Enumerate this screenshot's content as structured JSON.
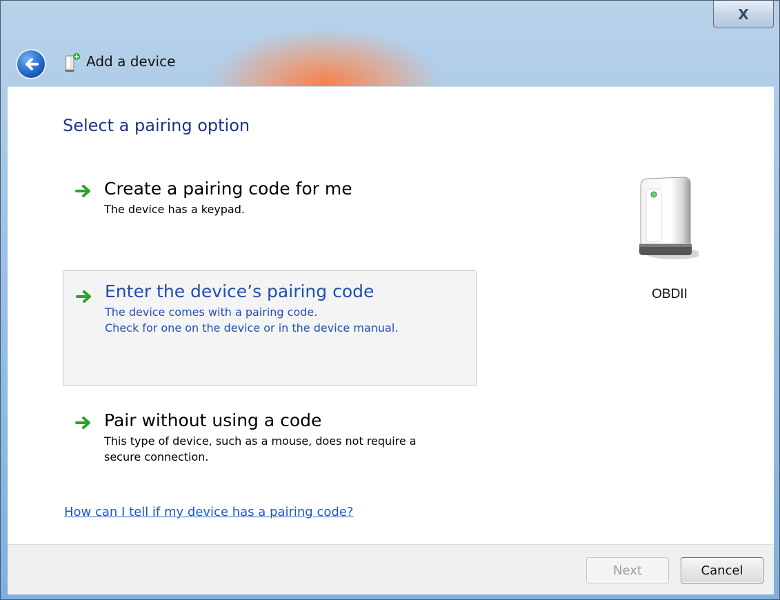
{
  "window": {
    "title": "Add a device",
    "close_label": "X"
  },
  "content": {
    "heading": "Select a pairing option",
    "options": [
      {
        "title": "Create a pairing code for me",
        "description": [
          "The device has a keypad."
        ],
        "selected": false
      },
      {
        "title": "Enter the device’s pairing code",
        "description": [
          "The device comes with a pairing code.",
          "Check for one on the device or in the device manual."
        ],
        "selected": true
      },
      {
        "title": "Pair without using a code",
        "description": [
          "This type of device, such as a mouse, does not require a",
          "secure connection."
        ],
        "selected": false
      }
    ],
    "help_link": "How can I tell if my device has a pairing code?",
    "device": {
      "name": "OBDII",
      "icon": "generic-device-icon"
    }
  },
  "footer": {
    "next_label": "Next",
    "next_enabled": false,
    "cancel_label": "Cancel"
  },
  "colors": {
    "heading": "#1e3287",
    "selected_text": "#1f4fae",
    "link": "#1a57c8",
    "arrow": "#2ca12c"
  }
}
